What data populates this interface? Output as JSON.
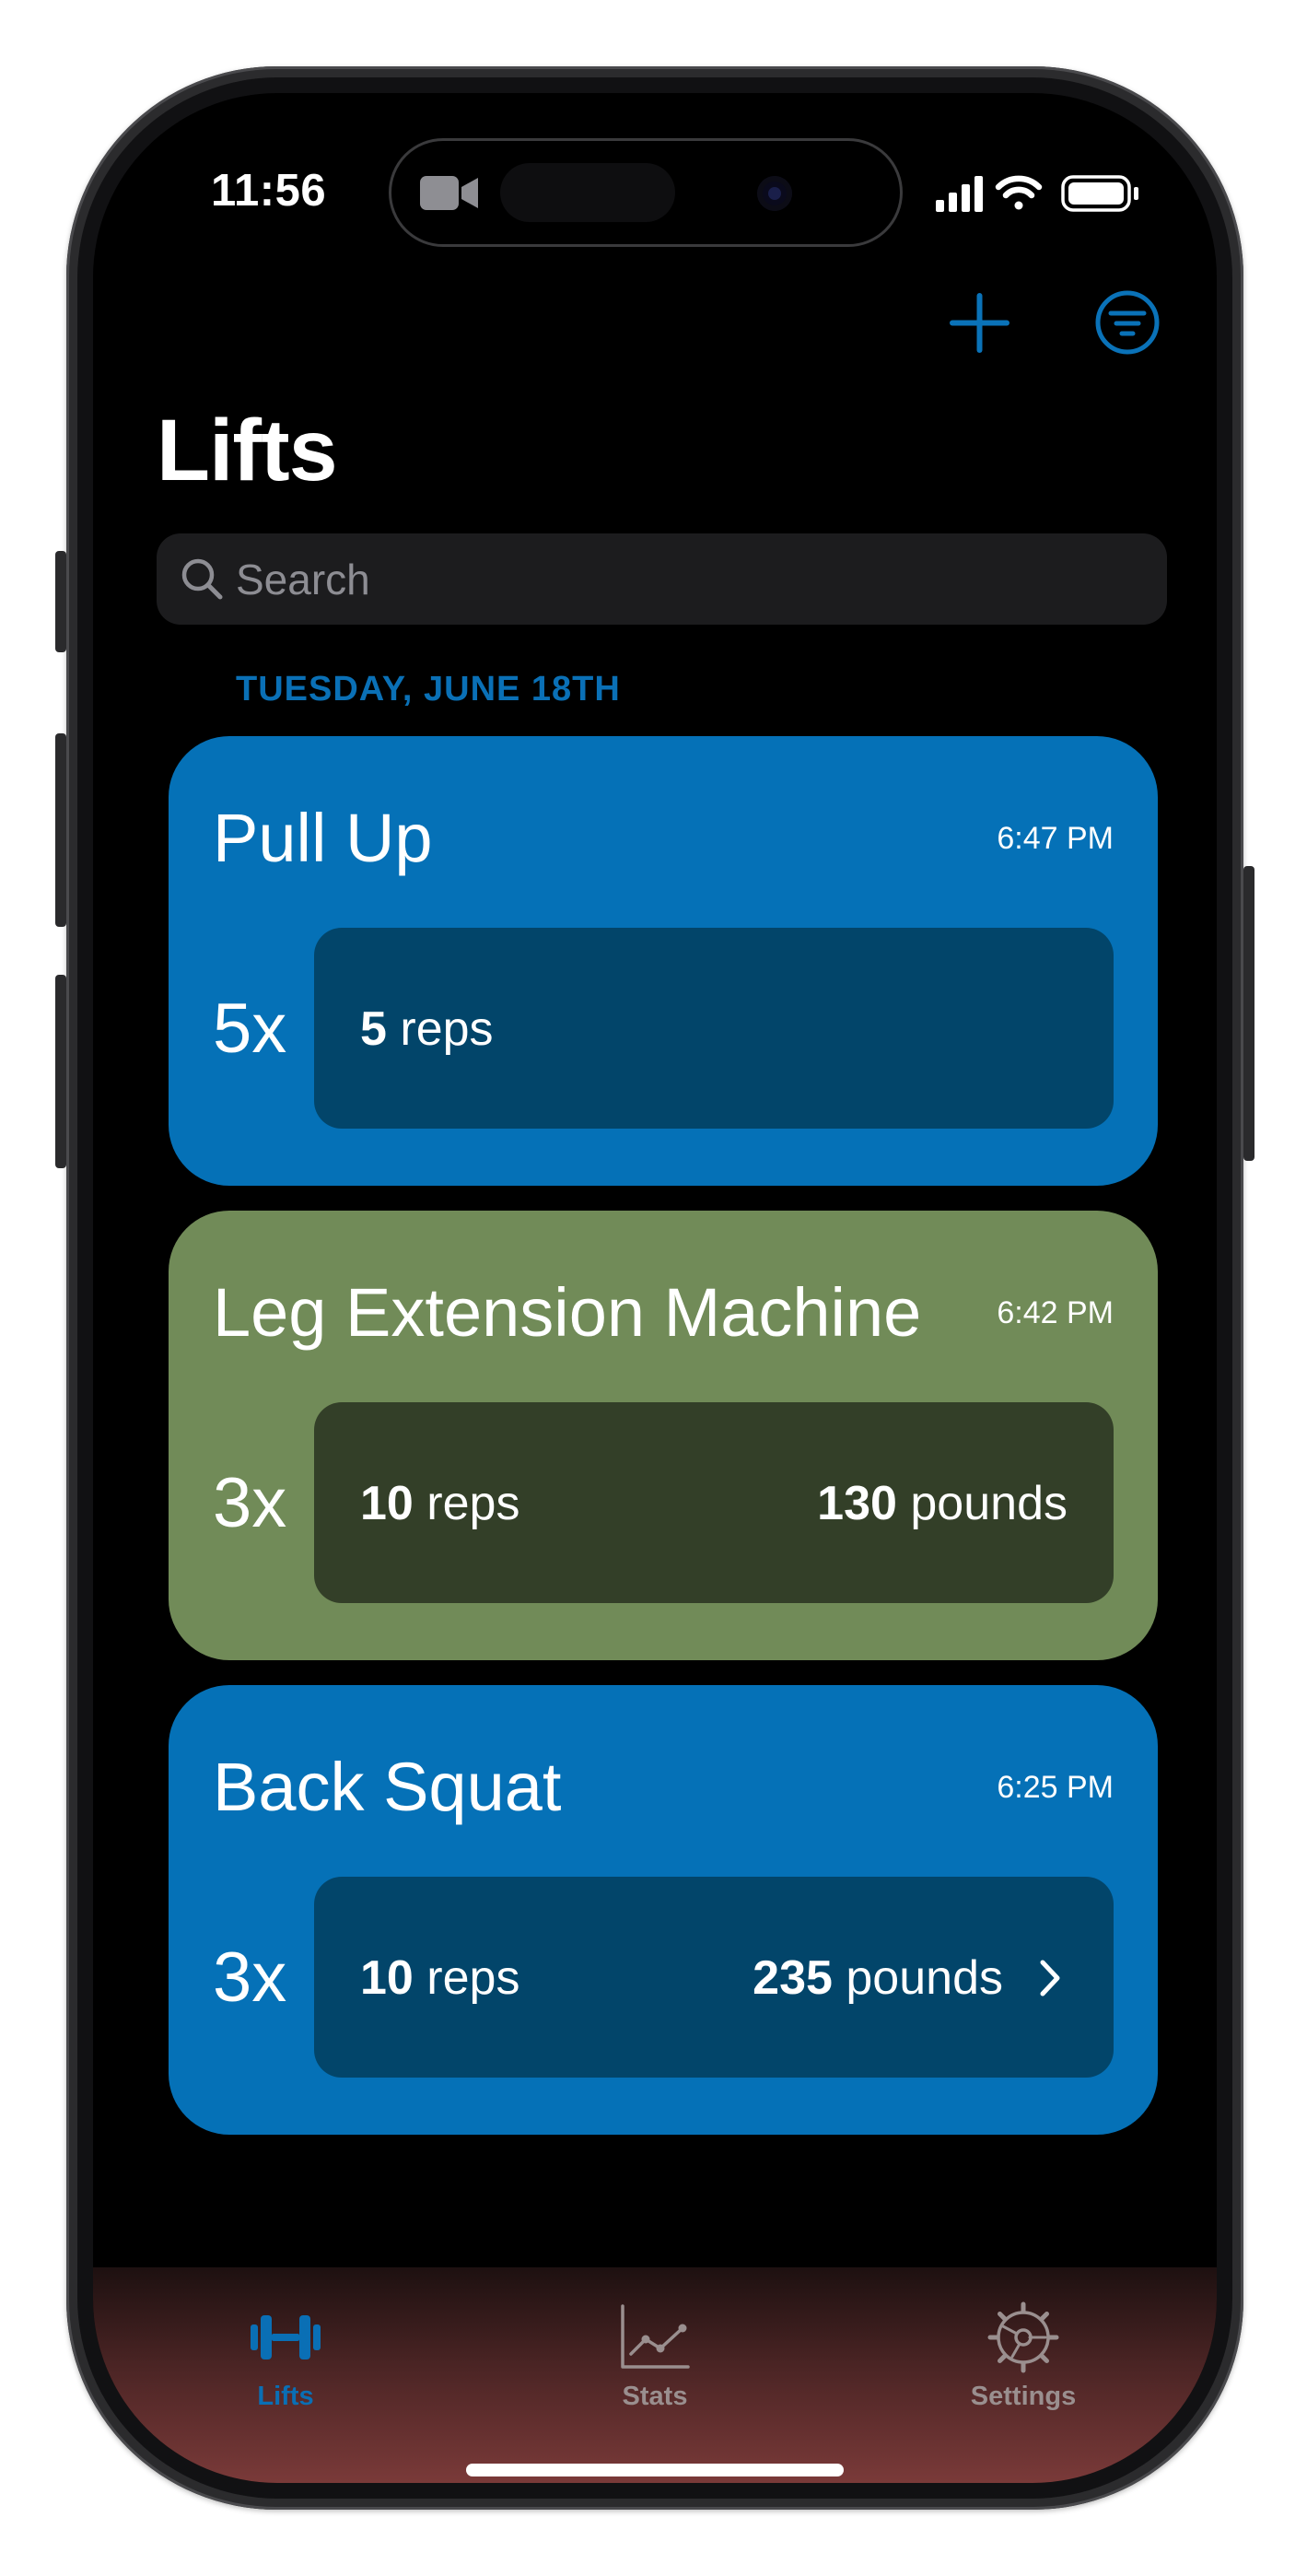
{
  "status_bar": {
    "time": "11:56"
  },
  "nav": {
    "add_icon": "plus-icon",
    "filter_icon": "filter-circle-icon"
  },
  "page": {
    "title": "Lifts"
  },
  "search": {
    "placeholder": "Search",
    "value": ""
  },
  "section": {
    "header": "TUESDAY, JUNE 18TH"
  },
  "lifts": [
    {
      "name": "Pull Up",
      "time": "6:47 PM",
      "sets": "5x",
      "reps_value": "5",
      "reps_unit": "reps",
      "weight_value": "",
      "weight_unit": "",
      "color": "#0571b7",
      "row_color": "#02456a"
    },
    {
      "name": "Leg Extension Machine",
      "time": "6:42 PM",
      "sets": "3x",
      "reps_value": "10",
      "reps_unit": "reps",
      "weight_value": "130",
      "weight_unit": "pounds",
      "color": "#718b58",
      "row_color": "#333f28"
    },
    {
      "name": "Back Squat",
      "time": "6:25 PM",
      "sets": "3x",
      "reps_value": "10",
      "reps_unit": "reps",
      "weight_value": "235",
      "weight_unit": "pounds",
      "color": "#0571b7",
      "row_color": "#02456a"
    }
  ],
  "tabbar": {
    "tabs": [
      {
        "label": "Lifts",
        "icon": "dumbbell-icon",
        "active": true
      },
      {
        "label": "Stats",
        "icon": "line-chart-icon",
        "active": false
      },
      {
        "label": "Settings",
        "icon": "gear-icon",
        "active": false
      }
    ],
    "active_color": "#0a6fb5",
    "inactive_color": "#9a8f8f"
  }
}
